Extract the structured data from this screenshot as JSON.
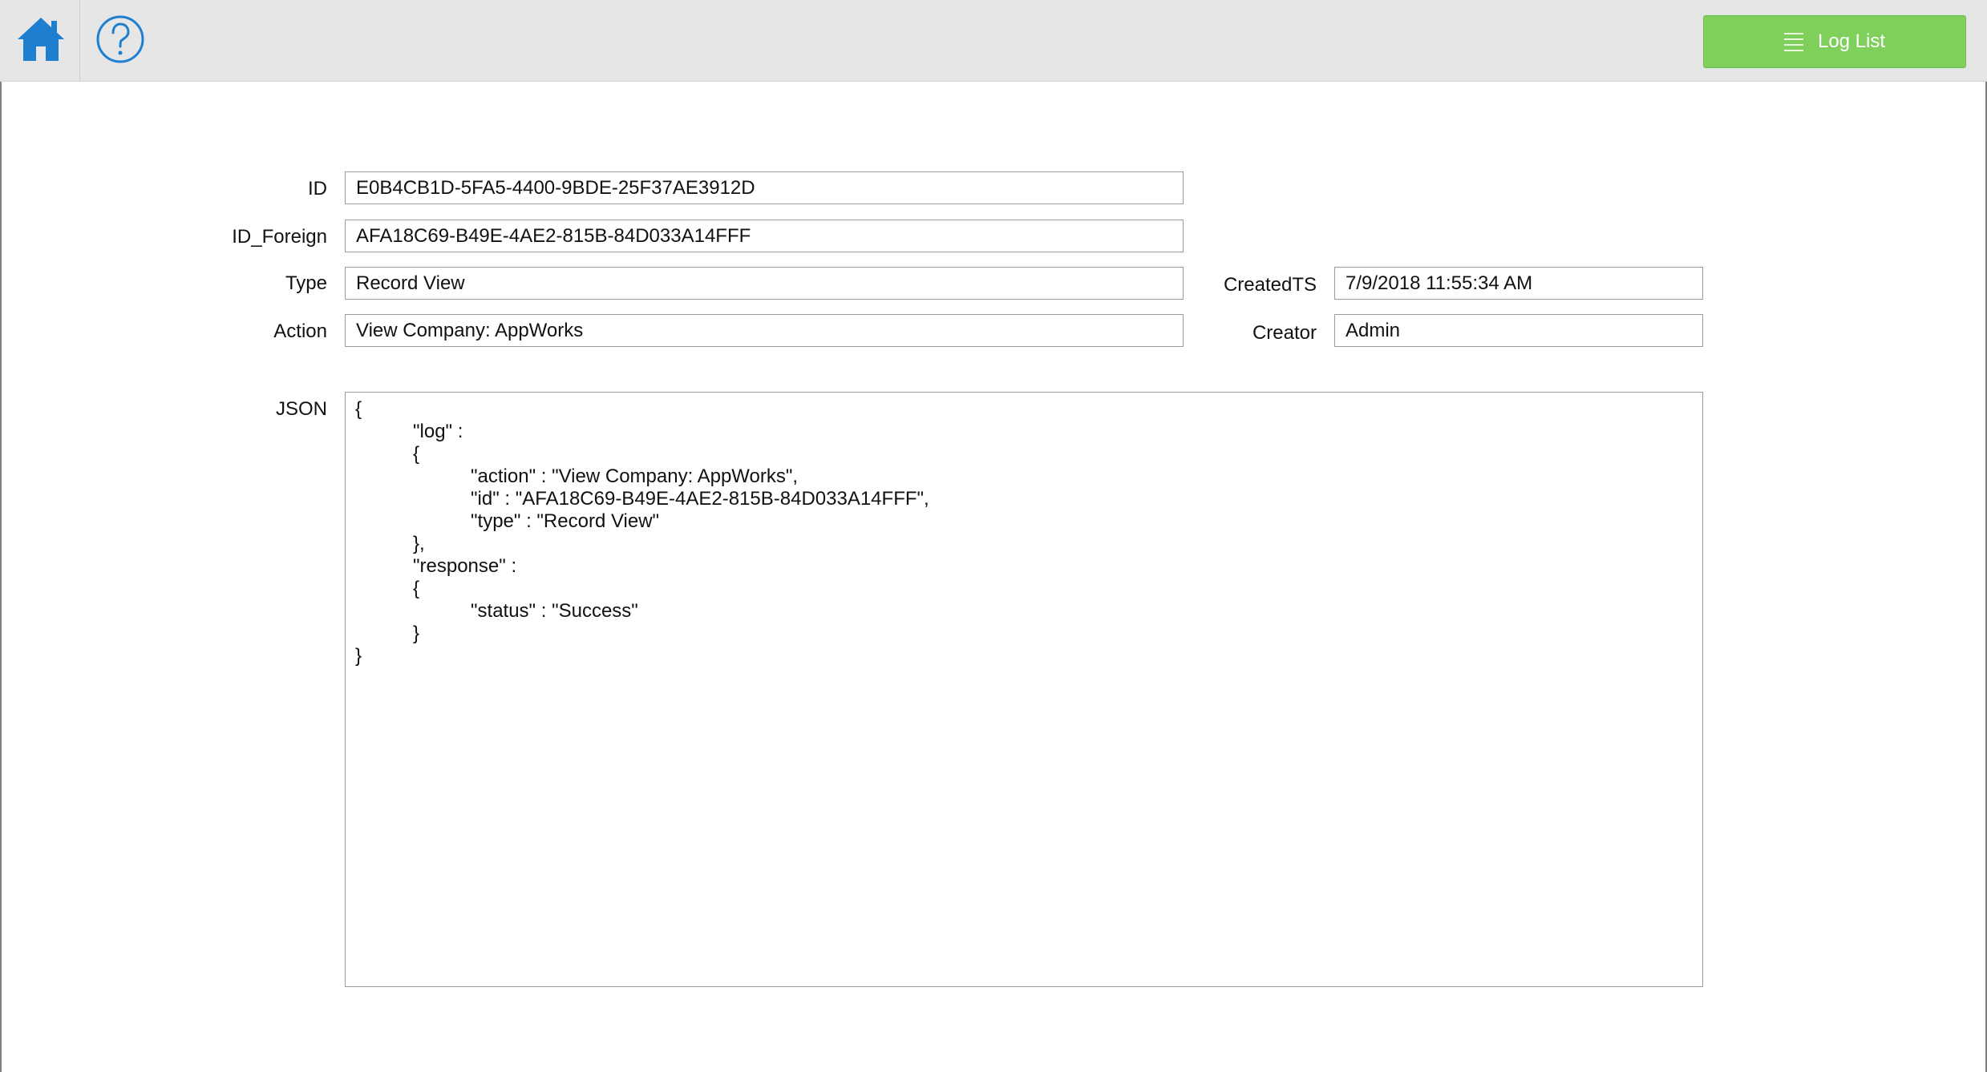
{
  "toolbar": {
    "home_icon": "home-icon",
    "help_icon": "help-circle-icon",
    "log_list_label": "Log List",
    "log_list_icon": "list-lines-icon",
    "accent_color": "#1e7fd0",
    "button_color": "#7fcf5b"
  },
  "form": {
    "id": {
      "label": "ID",
      "value": "E0B4CB1D-5FA5-4400-9BDE-25F37AE3912D"
    },
    "id_foreign": {
      "label": "ID_Foreign",
      "value": "AFA18C69-B49E-4AE2-815B-84D033A14FFF"
    },
    "type": {
      "label": "Type",
      "value": "Record View"
    },
    "action": {
      "label": "Action",
      "value": "View Company: AppWorks"
    },
    "created_ts": {
      "label": "CreatedTS",
      "value": "7/9/2018 11:55:34 AM"
    },
    "creator": {
      "label": "Creator",
      "value": "Admin"
    },
    "json": {
      "label": "JSON",
      "lines": [
        "{",
        "\"log\" :",
        "{",
        "\"action\" : \"View Company: AppWorks\",",
        "\"id\" : \"AFA18C69-B49E-4AE2-815B-84D033A14FFF\",",
        "\"type\" : \"Record View\"",
        "},",
        "\"response\" :",
        "{",
        "\"status\" : \"Success\"",
        "}",
        "}"
      ]
    }
  }
}
